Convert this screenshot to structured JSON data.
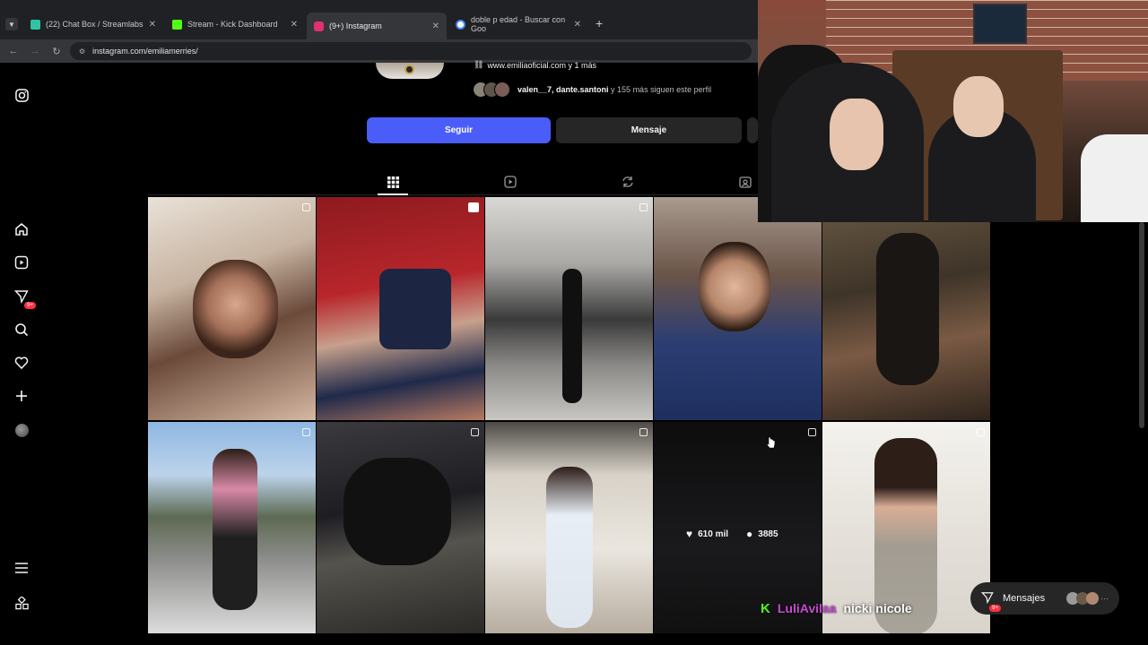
{
  "browser": {
    "tabs": [
      {
        "label": "(22) Chat Box / Streamlabs",
        "icon": "streamlabs-icon",
        "color": "#31c3a2"
      },
      {
        "label": "Stream - Kick Dashboard",
        "icon": "kick-icon",
        "color": "#53fc18"
      },
      {
        "label": "(9+) Instagram",
        "icon": "instagram-icon",
        "color": "#e1306c"
      },
      {
        "label": "doble p edad - Buscar con Goo",
        "icon": "google-icon",
        "color": "#4285f4"
      }
    ],
    "new_tab": "+",
    "url": "instagram.com/emiliamerries/"
  },
  "profile": {
    "link": "www.emiliaoficial.com y 1 más",
    "followed_by_users": "valen__7, dante.santoni",
    "followed_by_rest": " y 155 más siguen este perfil",
    "follow_label": "Seguir",
    "message_label": "Mensaje"
  },
  "sidebar": {
    "notification_badge": "9+"
  },
  "grid": {
    "hover_likes": "610 mil",
    "hover_comments": "3885"
  },
  "messages_bar": {
    "label": "Mensajes",
    "badge": "9+"
  },
  "stream_overlay": {
    "platform_letter": "K",
    "user": "LuliAvilaa",
    "text": "nicki nicole"
  },
  "colors": {
    "accent": "#4a5df9",
    "dark_button": "#262626",
    "highlight_user": "#c84bd6"
  }
}
